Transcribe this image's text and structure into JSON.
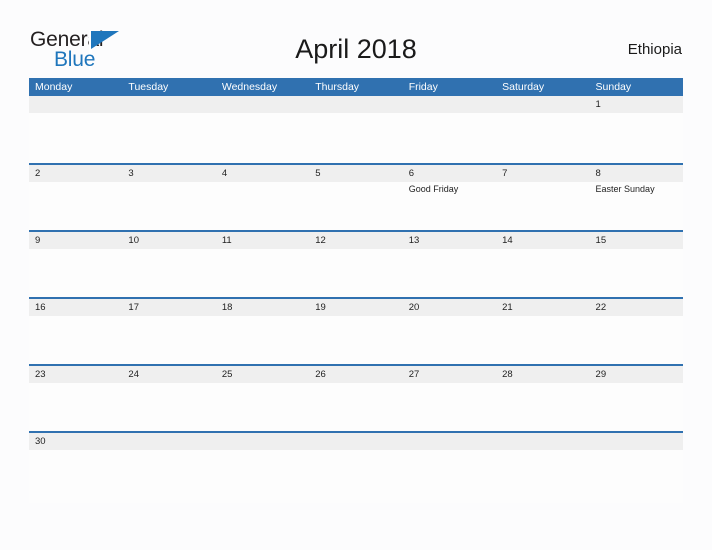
{
  "brand": {
    "name_part1": "General",
    "name_part2": "Blue",
    "triangle_icon": "triangle-icon",
    "primary_color": "#1f76bc"
  },
  "header": {
    "title": "April 2018",
    "country": "Ethiopia"
  },
  "calendar": {
    "header_color": "#3071b0",
    "number_band_color": "#efefef",
    "day_names": [
      "Monday",
      "Tuesday",
      "Wednesday",
      "Thursday",
      "Friday",
      "Saturday",
      "Sunday"
    ],
    "weeks": [
      {
        "days": [
          {
            "num": "",
            "event": ""
          },
          {
            "num": "",
            "event": ""
          },
          {
            "num": "",
            "event": ""
          },
          {
            "num": "",
            "event": ""
          },
          {
            "num": "",
            "event": ""
          },
          {
            "num": "",
            "event": ""
          },
          {
            "num": "1",
            "event": ""
          }
        ]
      },
      {
        "days": [
          {
            "num": "2",
            "event": ""
          },
          {
            "num": "3",
            "event": ""
          },
          {
            "num": "4",
            "event": ""
          },
          {
            "num": "5",
            "event": ""
          },
          {
            "num": "6",
            "event": "Good Friday"
          },
          {
            "num": "7",
            "event": ""
          },
          {
            "num": "8",
            "event": "Easter Sunday"
          }
        ]
      },
      {
        "days": [
          {
            "num": "9",
            "event": ""
          },
          {
            "num": "10",
            "event": ""
          },
          {
            "num": "11",
            "event": ""
          },
          {
            "num": "12",
            "event": ""
          },
          {
            "num": "13",
            "event": ""
          },
          {
            "num": "14",
            "event": ""
          },
          {
            "num": "15",
            "event": ""
          }
        ]
      },
      {
        "days": [
          {
            "num": "16",
            "event": ""
          },
          {
            "num": "17",
            "event": ""
          },
          {
            "num": "18",
            "event": ""
          },
          {
            "num": "19",
            "event": ""
          },
          {
            "num": "20",
            "event": ""
          },
          {
            "num": "21",
            "event": ""
          },
          {
            "num": "22",
            "event": ""
          }
        ]
      },
      {
        "days": [
          {
            "num": "23",
            "event": ""
          },
          {
            "num": "24",
            "event": ""
          },
          {
            "num": "25",
            "event": ""
          },
          {
            "num": "26",
            "event": ""
          },
          {
            "num": "27",
            "event": ""
          },
          {
            "num": "28",
            "event": ""
          },
          {
            "num": "29",
            "event": ""
          }
        ]
      },
      {
        "days": [
          {
            "num": "30",
            "event": ""
          },
          {
            "num": "",
            "event": ""
          },
          {
            "num": "",
            "event": ""
          },
          {
            "num": "",
            "event": ""
          },
          {
            "num": "",
            "event": ""
          },
          {
            "num": "",
            "event": ""
          },
          {
            "num": "",
            "event": ""
          }
        ]
      }
    ]
  }
}
